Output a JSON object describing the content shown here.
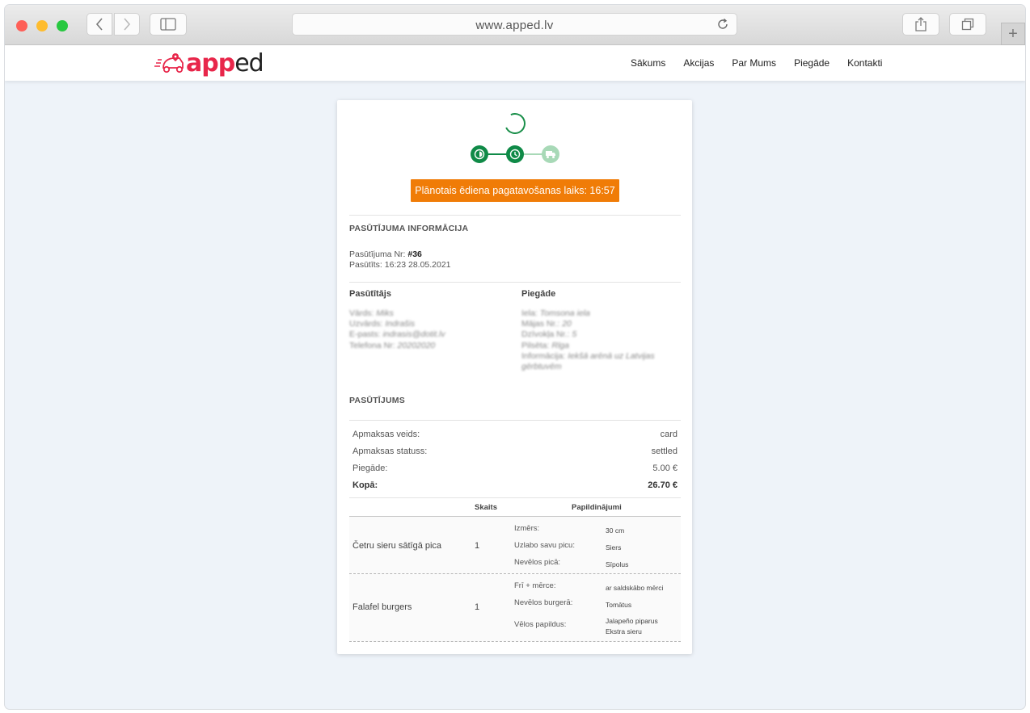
{
  "browser": {
    "url": "www.apped.lv"
  },
  "site": {
    "logo": {
      "brand_a": "app",
      "brand_b": "ed"
    },
    "nav": [
      "Sākums",
      "Akcijas",
      "Par Mums",
      "Piegāde",
      "Kontakti"
    ]
  },
  "order": {
    "eta_label": "Plānotais ēdiena pagatavošanas laiks: 16:57",
    "info_title": "PASŪTĪJUMA INFORMĀCIJA",
    "number_label": "Pasūtījuma Nr:",
    "number_value": "#36",
    "placed_label": "Pasūtīts:",
    "placed_value": "16:23 28.05.2021",
    "customer": {
      "title": "Pasūtītājs",
      "name_label": "Vārds:",
      "name_value": "Miks",
      "surname_label": "Uzvārds:",
      "surname_value": "Indrašis",
      "email_label": "E-pasts:",
      "email_value": "indrasis@dotit.lv",
      "phone_label": "Telefona Nr:",
      "phone_value": "20202020"
    },
    "delivery": {
      "title": "Piegāde",
      "street_label": "Iela:",
      "street_value": "Tomsona iela",
      "house_label": "Mājas Nr.:",
      "house_value": "20",
      "flat_label": "Dzīvokļa Nr.:",
      "flat_value": "5",
      "city_label": "Pilsēta:",
      "city_value": "Rīga",
      "info_label": "Informācija:",
      "info_value": "Iekšā arēnā uz Latvijas",
      "info_value_2": "gērbtuvēm"
    },
    "summary_title": "PASŪTĪJUMS",
    "summary": [
      {
        "label": "Apmaksas veids:",
        "value": "card"
      },
      {
        "label": "Apmaksas statuss:",
        "value": "settled"
      },
      {
        "label": "Piegāde:",
        "value": "5.00 €"
      },
      {
        "label": "Kopā:",
        "value": "26.70 €"
      }
    ],
    "table_headers": {
      "qty": "Skaits",
      "extras": "Papildinājumi"
    },
    "items": [
      {
        "name": "Četru sieru sātīgā pica",
        "qty": "1",
        "options": [
          {
            "label": "Izmērs:",
            "value": "30 cm"
          },
          {
            "label": "Uzlabo savu picu:",
            "value": "Siers"
          },
          {
            "label": "Nevēlos picā:",
            "value": "Sīpolus"
          }
        ]
      },
      {
        "name": "Falafel burgers",
        "qty": "1",
        "options": [
          {
            "label": "Frī + mērce:",
            "value": "ar saldskābo mērci"
          },
          {
            "label": "Nevēlos burgerā:",
            "value": "Tomātus"
          },
          {
            "label": "Vēlos papildus:",
            "value": "Jalapeño piparus",
            "value2": "Ekstra sieru"
          }
        ]
      }
    ]
  }
}
